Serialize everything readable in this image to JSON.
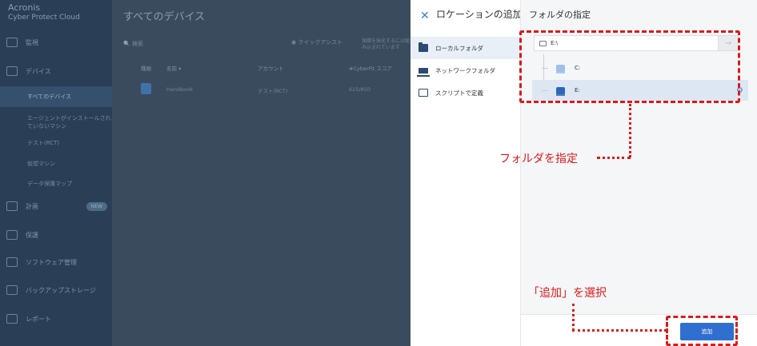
{
  "background": {
    "brand": {
      "title": "Acronis",
      "subtitle": "Cyber Protect Cloud"
    },
    "nav": [
      {
        "label": "監視"
      },
      {
        "label": "デバイス"
      },
      {
        "label": "すべてのデバイス"
      },
      {
        "label": "エージェントがインストールされていないマシン"
      },
      {
        "label": "テスト(RCT)"
      },
      {
        "label": "仮想マシン"
      },
      {
        "label": "データ保護マップ"
      },
      {
        "label": "計画",
        "badge": "NEW"
      },
      {
        "label": "保護"
      },
      {
        "label": "ソフトウェア管理"
      },
      {
        "label": "バックアップストレージ"
      },
      {
        "label": "レポート"
      }
    ],
    "page_title": "すべてのデバイス",
    "search_label": "検索",
    "quick_assist": "クイックアシスト",
    "quick_assist_note": "保護を強化するには組み込まれています",
    "columns": [
      "種類",
      "名前 ▾",
      "アカウント",
      "#CyberFit スコア"
    ],
    "row": {
      "name": "Handbook",
      "account": "テスト(RCT)",
      "score": "625/850"
    }
  },
  "panel": {
    "close_icon": "close-icon",
    "title": "ロケーションの追加",
    "locations": [
      {
        "label": "ローカルフォルダ",
        "icon": "folder-icon"
      },
      {
        "label": "ネットワークフォルダ",
        "icon": "network-folder-icon"
      },
      {
        "label": "スクリプトで定義",
        "icon": "script-icon"
      }
    ],
    "right_title": "フォルダの指定",
    "path_value": "E:\\",
    "go_icon": "→",
    "tree": [
      {
        "label": "C:"
      },
      {
        "label": "E:"
      }
    ],
    "add_button": "追加"
  },
  "annotations": {
    "folder_note": "フォルダを指定",
    "add_note": "「追加」を選択",
    "color": "#e01818"
  }
}
